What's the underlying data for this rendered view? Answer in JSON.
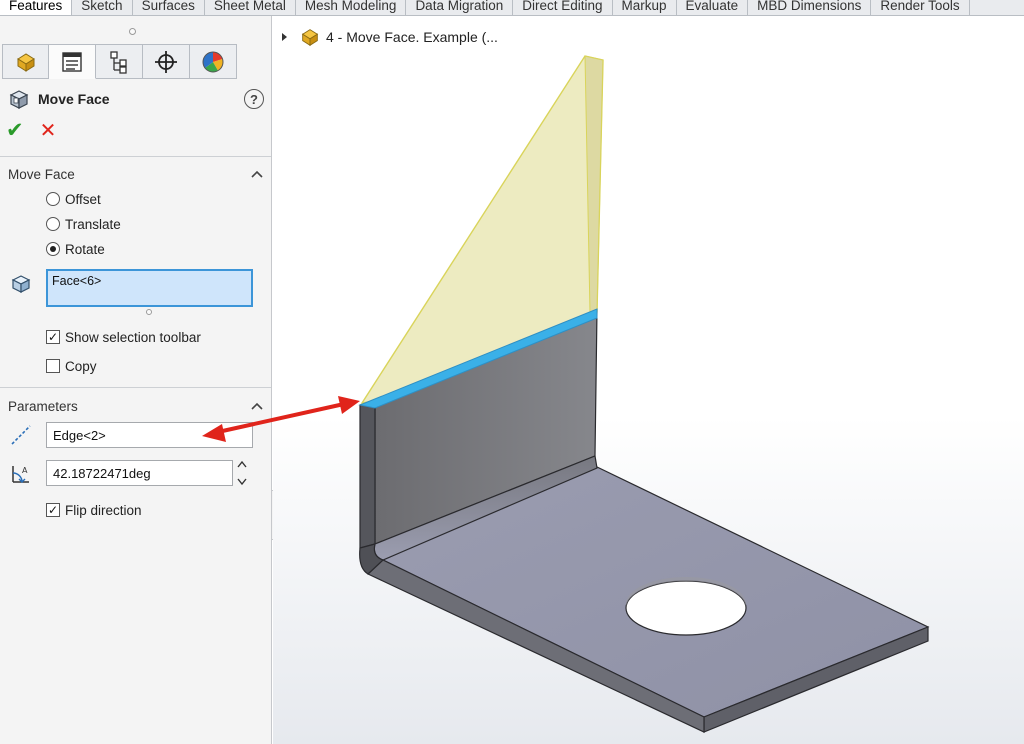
{
  "command_tabs": [
    "Features",
    "Sketch",
    "Surfaces",
    "Sheet Metal",
    "Mesh Modeling",
    "Data Migration",
    "Direct Editing",
    "Markup",
    "Evaluate",
    "MBD Dimensions",
    "Render Tools"
  ],
  "property_manager": {
    "tab_icons": [
      "feature-manager-icon",
      "property-manager-icon",
      "configuration-manager-icon",
      "dimxpert-manager-icon",
      "display-manager-icon"
    ],
    "title": "Move Face",
    "help_label": "?",
    "ok_label": "✔",
    "cancel_label": "✕",
    "move_face_group": {
      "heading": "Move Face",
      "options": [
        "Offset",
        "Translate",
        "Rotate"
      ],
      "selected_option": "Rotate",
      "faces_value": "Face<6>",
      "show_selection_toolbar_label": "Show selection toolbar",
      "show_selection_toolbar_checked": true,
      "copy_label": "Copy",
      "copy_checked": false
    },
    "parameters_group": {
      "heading": "Parameters",
      "axis_value": "Edge<2>",
      "angle_value": "42.18722471deg",
      "flip_direction_label": "Flip direction",
      "flip_direction_checked": true
    }
  },
  "feature_tree": {
    "root_label": "4 - Move Face. Example (..."
  },
  "colors": {
    "panel_bg": "#f4f4f4",
    "selection_box": "#cfe5fb",
    "selection_border": "#3c95d8",
    "ok_green": "#2a9a2a",
    "cancel_red": "#e0241b",
    "highlight_edge": "#3ab0e8",
    "preview_face": "#e8e6b0",
    "annotation_arrow": "#e0241b"
  }
}
